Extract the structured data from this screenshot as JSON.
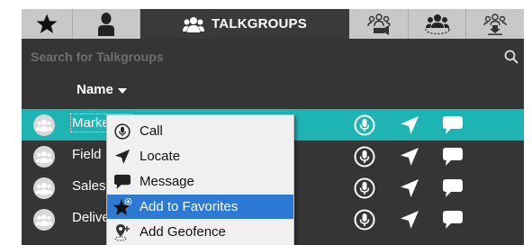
{
  "tabs": [
    {
      "id": "favorites",
      "icon": "star-icon"
    },
    {
      "id": "contacts",
      "icon": "person-icon"
    },
    {
      "id": "talkgroups",
      "icon": "group-icon",
      "label": "TALKGROUPS",
      "active": true
    },
    {
      "id": "broadcast",
      "icon": "group-broadcast-icon"
    },
    {
      "id": "dynamic-groups",
      "icon": "group-circle-icon"
    },
    {
      "id": "download-groups",
      "icon": "group-download-icon"
    }
  ],
  "search": {
    "placeholder": "Search for Talkgroups",
    "value": ""
  },
  "columns": {
    "name": "Name"
  },
  "rows": [
    {
      "name": "Marketing",
      "selected": true
    },
    {
      "name": "Field"
    },
    {
      "name": "Sales"
    },
    {
      "name": "Delivery"
    }
  ],
  "context_menu": {
    "items": [
      {
        "label": "Call",
        "icon": "microphone-icon"
      },
      {
        "label": "Locate",
        "icon": "location-arrow-icon"
      },
      {
        "label": "Message",
        "icon": "message-icon"
      },
      {
        "label": "Add to Favorites",
        "icon": "star-add-icon",
        "highlighted": true
      },
      {
        "label": "Add Geofence",
        "icon": "geofence-pin-icon"
      }
    ]
  },
  "colors": {
    "background": "#353535",
    "selected_row": "#1eb4b4",
    "menu_highlight": "#2c7ad6",
    "tab_inactive": "#c8c8c8"
  }
}
